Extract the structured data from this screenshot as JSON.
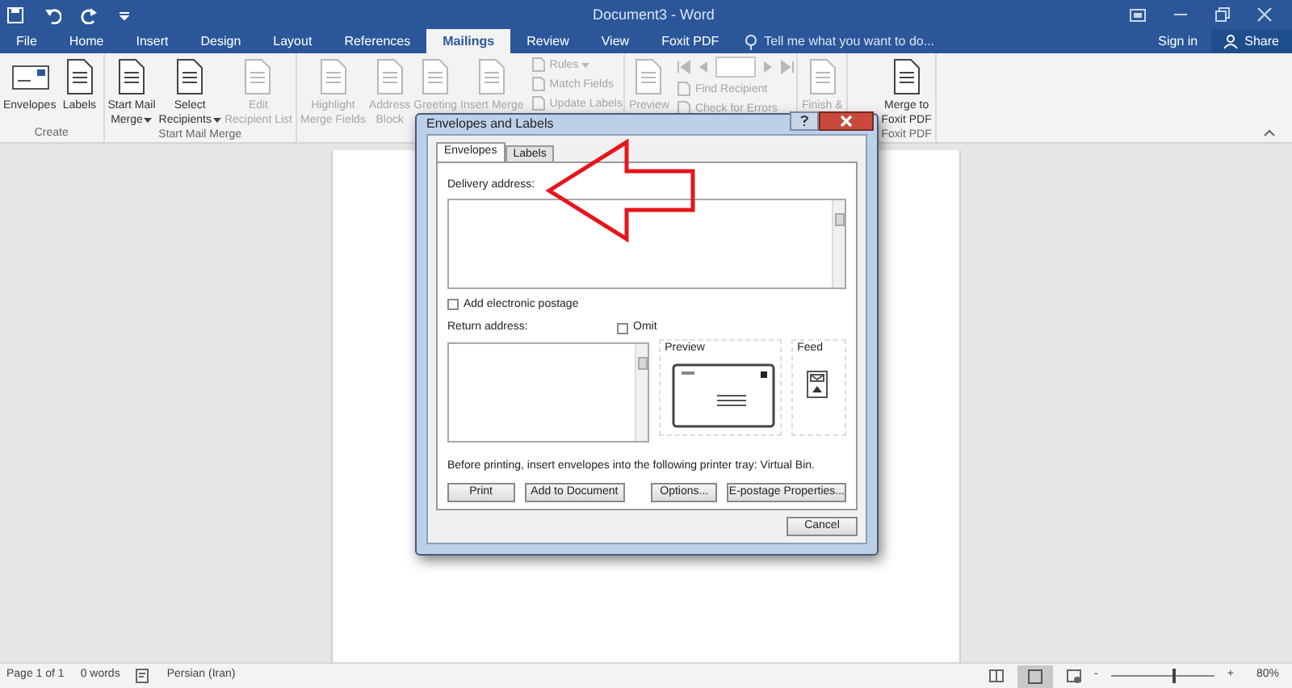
{
  "window": {
    "title": "Document3 - Word"
  },
  "tabs": [
    {
      "label": "File",
      "selected": false
    },
    {
      "label": "Home",
      "selected": false
    },
    {
      "label": "Insert",
      "selected": false
    },
    {
      "label": "Design",
      "selected": false
    },
    {
      "label": "Layout",
      "selected": false
    },
    {
      "label": "References",
      "selected": false
    },
    {
      "label": "Mailings",
      "selected": true
    },
    {
      "label": "Review",
      "selected": false
    },
    {
      "label": "View",
      "selected": false
    },
    {
      "label": "Foxit PDF",
      "selected": false
    }
  ],
  "tell_me": {
    "placeholder": "Tell me what you want to do..."
  },
  "account": {
    "sign_in": "Sign in",
    "share": "Share"
  },
  "ribbon": {
    "groups": [
      {
        "label": "Create",
        "buttons": [
          {
            "kind": "large",
            "lines": [
              "Envelopes"
            ],
            "disabled": false,
            "dropdown": false
          },
          {
            "kind": "large",
            "lines": [
              "Labels"
            ],
            "disabled": false,
            "dropdown": false
          }
        ]
      },
      {
        "label": "Start Mail Merge",
        "buttons": [
          {
            "kind": "large",
            "lines": [
              "Start Mail",
              "Merge"
            ],
            "disabled": false,
            "dropdown": true
          },
          {
            "kind": "large",
            "lines": [
              "Select",
              "Recipients"
            ],
            "disabled": false,
            "dropdown": true
          },
          {
            "kind": "large",
            "lines": [
              "Edit",
              "Recipient List"
            ],
            "disabled": true,
            "dropdown": false
          }
        ]
      },
      {
        "buttons": [
          {
            "kind": "large",
            "lines": [
              "Highlight",
              "Merge Fields"
            ],
            "disabled": true,
            "dropdown": false
          },
          {
            "kind": "large",
            "lines": [
              "Address",
              "Block"
            ],
            "disabled": true,
            "dropdown": false
          },
          {
            "kind": "large",
            "lines": [
              "Greeting"
            ],
            "disabled": true,
            "dropdown": false
          },
          {
            "kind": "large",
            "lines": [
              "Insert Merge"
            ],
            "disabled": true,
            "dropdown": false
          },
          {
            "kind": "small",
            "lines": [
              "Rules"
            ],
            "disabled": true,
            "dropdown": true
          },
          {
            "kind": "small",
            "lines": [
              "Match Fields"
            ],
            "disabled": true,
            "dropdown": false
          },
          {
            "kind": "small",
            "lines": [
              "Update Labels"
            ],
            "disabled": true,
            "dropdown": false
          }
        ]
      },
      {
        "buttons": [
          {
            "kind": "large",
            "lines": [
              "Preview"
            ],
            "disabled": true,
            "dropdown": false
          },
          {
            "kind": "nav",
            "disabled": true
          },
          {
            "kind": "small",
            "lines": [
              "Find Recipient"
            ],
            "disabled": true,
            "dropdown": false
          },
          {
            "kind": "small",
            "lines": [
              "Check for Errors"
            ],
            "disabled": true,
            "dropdown": false
          }
        ]
      },
      {
        "buttons": [
          {
            "kind": "large",
            "lines": [
              "Finish &"
            ],
            "disabled": true,
            "dropdown": false
          }
        ]
      },
      {
        "label": "Foxit PDF",
        "buttons": [
          {
            "kind": "large",
            "lines": [
              "Merge to",
              "Foxit PDF"
            ],
            "disabled": false,
            "dropdown": false
          }
        ]
      }
    ]
  },
  "dialog": {
    "title": "Envelopes and Labels",
    "tabs": [
      {
        "label": "Envelopes",
        "selected": true
      },
      {
        "label": "Labels",
        "selected": false
      }
    ],
    "delivery_label": "Delivery address:",
    "add_postage": {
      "label": "Add electronic postage",
      "checked": false
    },
    "return_label": "Return address:",
    "omit": {
      "label": "Omit",
      "checked": false
    },
    "preview_label": "Preview",
    "feed_label": "Feed",
    "note": "Before printing, insert envelopes into the following printer tray: Virtual Bin.",
    "buttons": [
      "Print",
      "Add to Document",
      "Options...",
      "E-postage Properties..."
    ],
    "cancel": "Cancel"
  },
  "status_bar": {
    "page": "Page 1 of 1",
    "words": "0 words",
    "language": "Persian (Iran)",
    "zoom_minus": "-",
    "zoom_plus": "+",
    "zoom": "80%",
    "zoom_level": {
      "level": 0.6
    }
  }
}
